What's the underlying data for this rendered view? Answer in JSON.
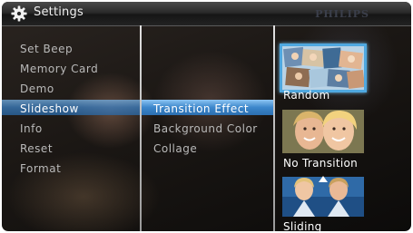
{
  "header": {
    "title": "Settings",
    "brand": "PHILIPS"
  },
  "menu": {
    "items": [
      {
        "label": "Set Beep"
      },
      {
        "label": "Memory Card"
      },
      {
        "label": "Demo"
      },
      {
        "label": "Slideshow"
      },
      {
        "label": "Info"
      },
      {
        "label": "Reset"
      },
      {
        "label": "Format"
      }
    ],
    "selected": "Slideshow"
  },
  "submenu": {
    "items": [
      {
        "label": "Transition Effect"
      },
      {
        "label": "Background Color"
      },
      {
        "label": "Collage"
      }
    ],
    "selected": "Transition Effect"
  },
  "options": {
    "items": [
      {
        "label": "Random",
        "icon": "random-collage-thumbnail"
      },
      {
        "label": "No Transition",
        "icon": "portrait-thumbnail"
      },
      {
        "label": "Sliding",
        "icon": "sliding-thumbnail"
      }
    ],
    "selected": "Random"
  },
  "colors": {
    "highlight": "#3b7fc2",
    "thumbnail_border": "#4fa8e0"
  }
}
